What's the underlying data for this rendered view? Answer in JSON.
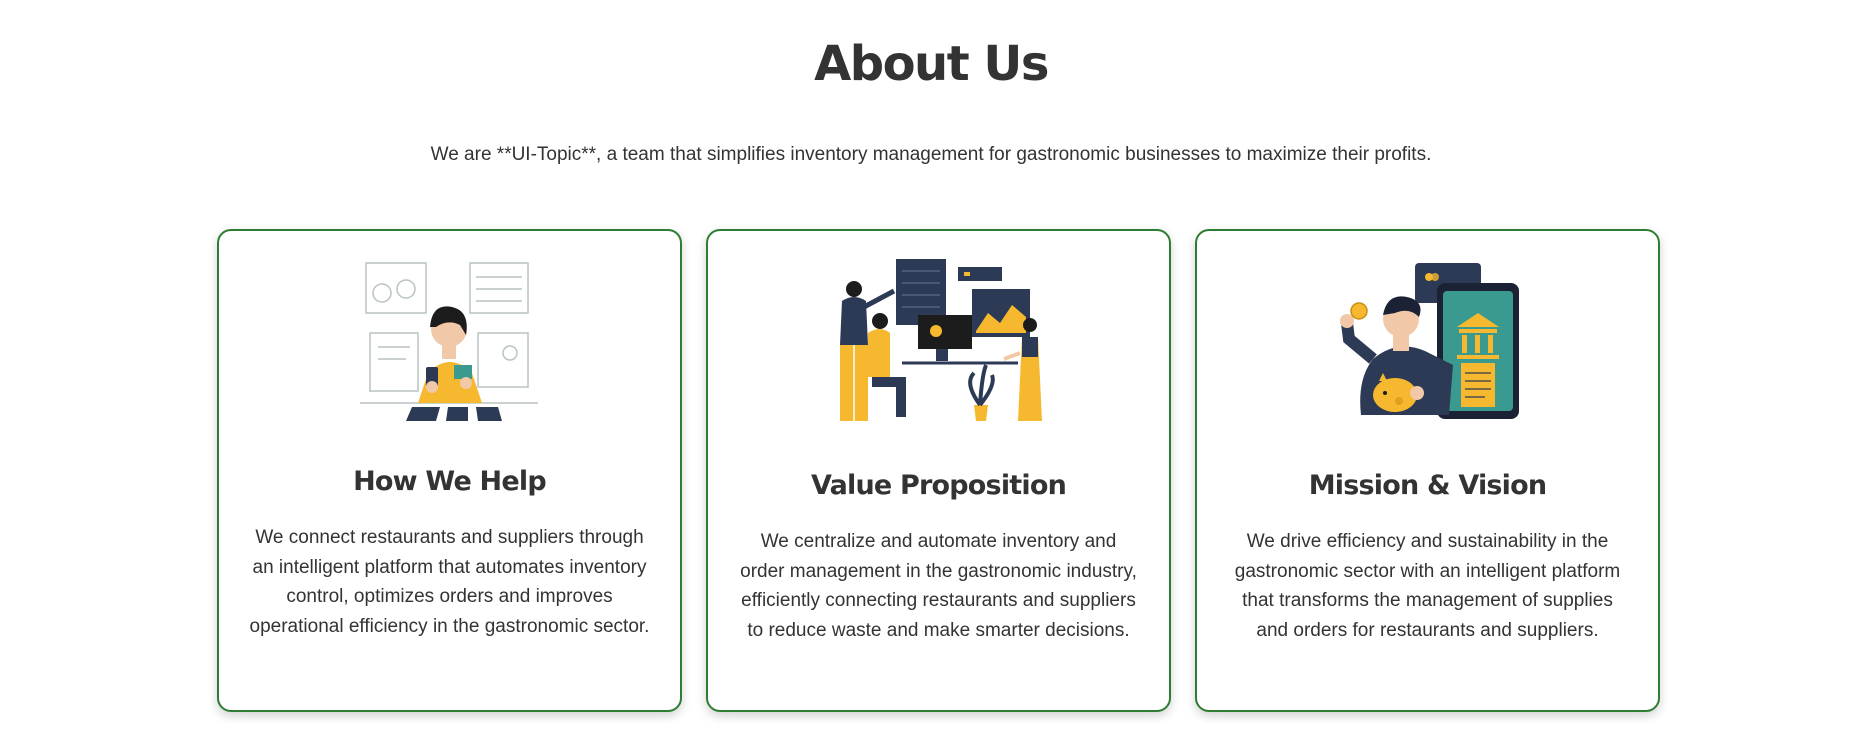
{
  "section": {
    "title": "About Us",
    "subtitle": "We are **UI-Topic**, a team that simplifies inventory management for gastronomic businesses to maximize their profits."
  },
  "colors": {
    "border_green": "#2e7d32",
    "accent_yellow": "#f5b82e",
    "navy": "#2d3a55",
    "teal": "#3a9a8f",
    "text": "#333333"
  },
  "cards": [
    {
      "icon": "phone-payment-illustration",
      "title": "How We Help",
      "text": "We connect restaurants and suppliers through an intelligent platform that automates inventory control, optimizes orders and improves operational efficiency in the gastronomic sector."
    },
    {
      "icon": "team-dashboard-illustration",
      "title": "Value Proposition",
      "text": "We centralize and automate inventory and order management in the gastronomic industry, efficiently connecting restaurants and suppliers to reduce waste and make smarter decisions."
    },
    {
      "icon": "bank-savings-illustration",
      "title": "Mission & Vision",
      "text": "We drive efficiency and sustainability in the gastronomic sector with an intelligent platform that transforms the management of supplies and orders for restaurants and suppliers."
    }
  ]
}
